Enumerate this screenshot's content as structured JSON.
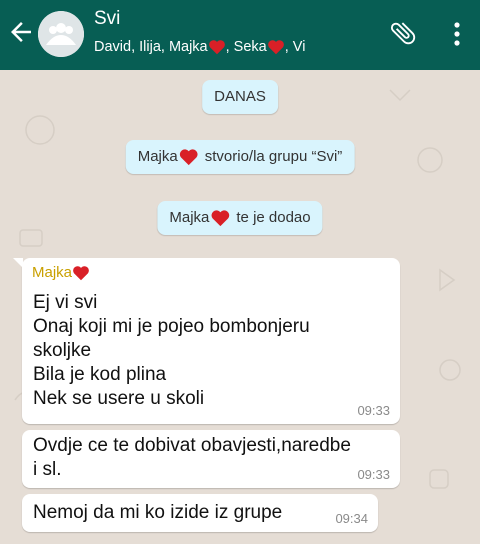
{
  "header": {
    "title": "Svi",
    "members": [
      {
        "text": "David, Ilija, Majka",
        "heart": true
      },
      {
        "text": ", Seka",
        "heart": true
      },
      {
        "text": ", Vi",
        "heart": false
      }
    ]
  },
  "chat": {
    "date_label": "DANAS",
    "system": [
      {
        "name": "Majka",
        "text": "stvorio/la grupu “Svi”"
      },
      {
        "name": "Majka",
        "text": "te je dodao"
      }
    ],
    "messages": [
      {
        "sender": "Majka",
        "lines": [
          "Ej vi svi",
          "Onaj koji mi je pojeo bombonjeru",
          "skoljke",
          "Bila je kod plina",
          "Nek se usere u skoli"
        ],
        "time": "09:33"
      },
      {
        "lines": [
          "Ovdje ce te dobivat obavjesti,naredbe",
          "i sl."
        ],
        "time": "09:33"
      },
      {
        "lines": [
          "Nemoj da mi ko izide iz grupe"
        ],
        "time": "09:34"
      }
    ]
  },
  "colors": {
    "header": "#075e54",
    "chat_bg": "#e5ddd5",
    "system_bubble": "#d9f4fd",
    "sender_name": "#c9a000",
    "heart": "#d92027"
  },
  "icons": [
    "back-arrow-icon",
    "group-avatar-icon",
    "heart-icon",
    "attachment-icon",
    "more-vert-icon"
  ]
}
